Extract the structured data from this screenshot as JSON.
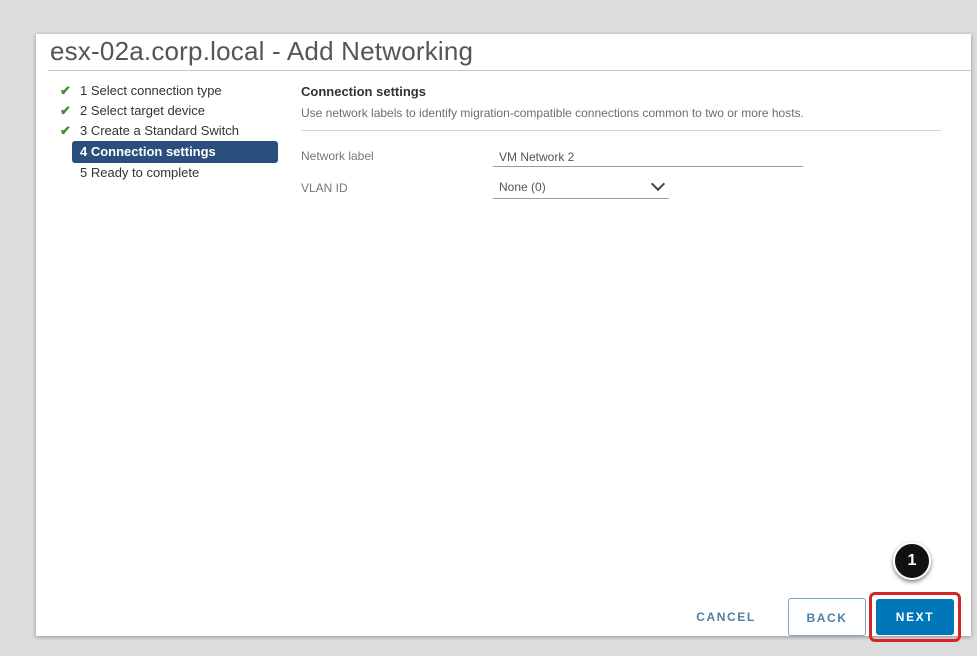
{
  "dialog": {
    "title": "esx-02a.corp.local - Add Networking"
  },
  "steps": [
    {
      "label": "1 Select connection type",
      "done": true
    },
    {
      "label": "2 Select target device",
      "done": true
    },
    {
      "label": "3 Create a Standard Switch",
      "done": true
    },
    {
      "label": "4 Connection settings",
      "active": true
    },
    {
      "label": "5 Ready to complete"
    }
  ],
  "content": {
    "title": "Connection settings",
    "description": "Use network labels to identify migration-compatible connections common to two or more hosts.",
    "network_label": {
      "label": "Network label",
      "value": "VM Network 2"
    },
    "vlan_id": {
      "label": "VLAN ID",
      "value": "None (0)"
    }
  },
  "footer": {
    "cancel": "CANCEL",
    "back": "BACK",
    "next": "NEXT"
  },
  "annotation": {
    "number": "1",
    "color": "#d3262a"
  },
  "colors": {
    "active_step_bg": "#2b4f7c",
    "check": "#3e8e2e",
    "primary": "#0075b8",
    "link": "#4f81a8"
  },
  "icons": {
    "check": "check-icon",
    "dropdown": "chevron-down-icon"
  }
}
